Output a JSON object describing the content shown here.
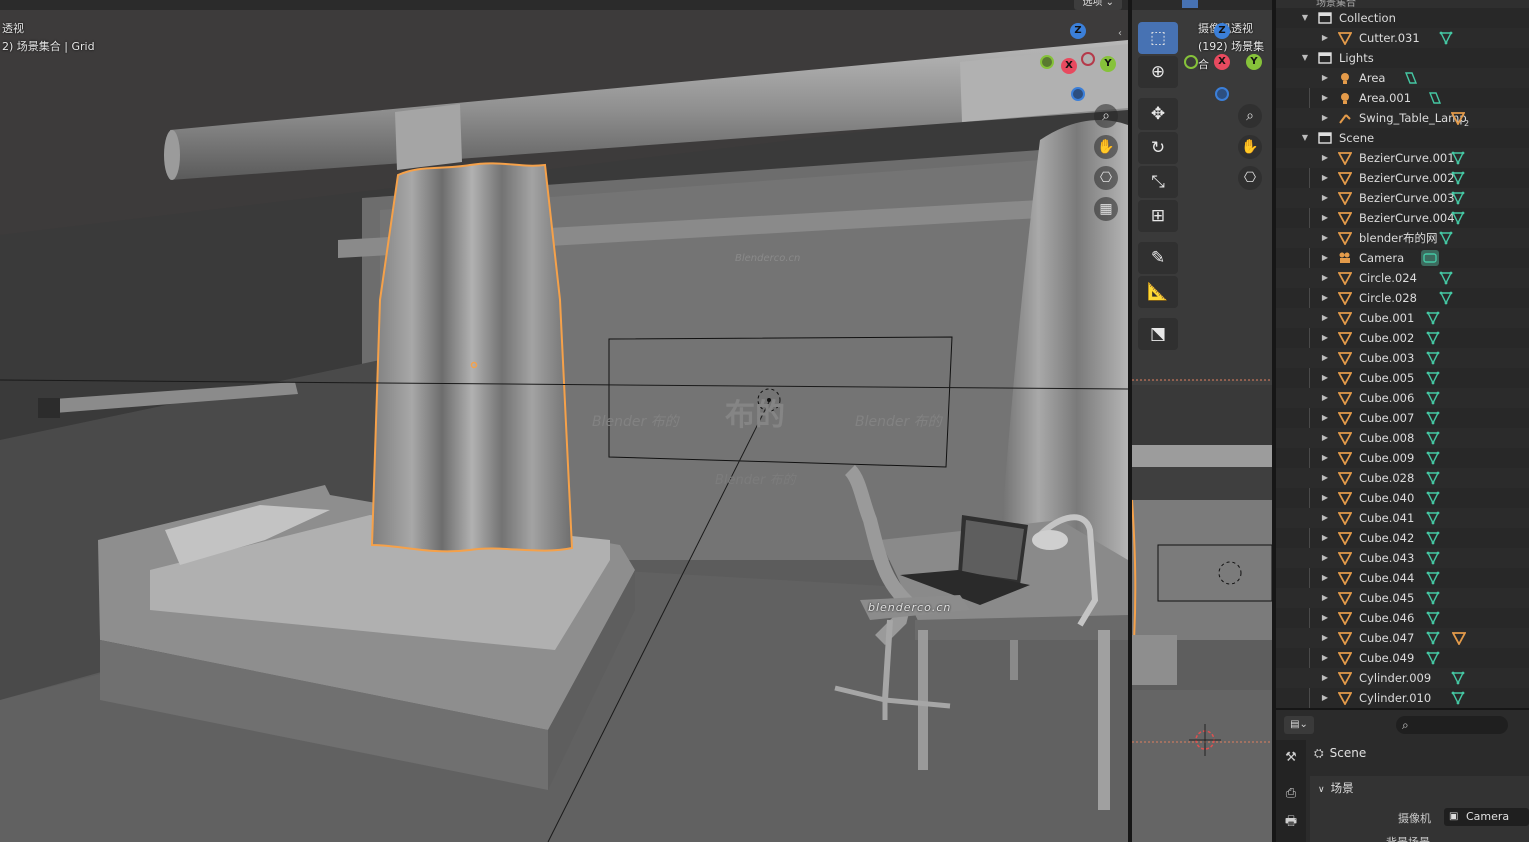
{
  "viewport_main": {
    "label_line1": "透视",
    "label_line2": "2) 场景集合 | Grid",
    "options_label": "选项 ⌄",
    "watermarks": [
      "Blenderco.cn",
      "布的",
      "Blender 布的",
      "Blender 布的",
      "Blender 布的",
      "blenderco.cn"
    ],
    "axes": {
      "z": "Z",
      "x": "X",
      "y": "Y"
    },
    "nav_tools": [
      "zoom-icon",
      "hand-icon",
      "camera-icon",
      "grid-icon"
    ]
  },
  "viewport_side": {
    "label_line1": "摄像机透视",
    "label_line2": "(192) 场景集合",
    "axes": {
      "z": "Z",
      "x": "X",
      "y": "Y"
    },
    "tools": [
      "select-box-icon",
      "cursor-icon",
      "move-icon",
      "rotate-icon",
      "scale-icon",
      "transform-icon",
      "annotate-icon",
      "measure-icon",
      "add-cube-icon"
    ]
  },
  "outliner": {
    "header": "场景集合",
    "rows": [
      {
        "name": "Collection",
        "type": "collection",
        "depth": 0,
        "expanded": true
      },
      {
        "name": "Cutter.031",
        "type": "mesh",
        "depth": 1,
        "extra": "mesh-data"
      },
      {
        "name": "Lights",
        "type": "collection",
        "depth": 0,
        "expanded": true
      },
      {
        "name": "Area",
        "type": "light",
        "depth": 1,
        "extra": "light-data"
      },
      {
        "name": "Area.001",
        "type": "light",
        "depth": 1,
        "extra": "light-data"
      },
      {
        "name": "Swing_Table_Lamp",
        "type": "armature",
        "depth": 1,
        "extra": "mesh-multi",
        "extra_count": "2"
      },
      {
        "name": "Scene",
        "type": "collection",
        "depth": 0,
        "expanded": true
      },
      {
        "name": "BezierCurve.001",
        "type": "mesh",
        "depth": 1,
        "extra": "mesh-data"
      },
      {
        "name": "BezierCurve.002",
        "type": "mesh",
        "depth": 1,
        "extra": "mesh-data"
      },
      {
        "name": "BezierCurve.003",
        "type": "mesh",
        "depth": 1,
        "extra": "mesh-data"
      },
      {
        "name": "BezierCurve.004",
        "type": "mesh",
        "depth": 1,
        "extra": "mesh-data"
      },
      {
        "name": "blender布的网",
        "type": "mesh",
        "depth": 1,
        "extra": "mesh-data"
      },
      {
        "name": "Camera",
        "type": "camera",
        "depth": 1,
        "extra": "camera-data"
      },
      {
        "name": "Circle.024",
        "type": "mesh",
        "depth": 1,
        "extra": "mesh-data"
      },
      {
        "name": "Circle.028",
        "type": "mesh",
        "depth": 1,
        "extra": "mesh-data"
      },
      {
        "name": "Cube.001",
        "type": "mesh",
        "depth": 1,
        "extra": "mesh-data"
      },
      {
        "name": "Cube.002",
        "type": "mesh",
        "depth": 1,
        "extra": "mesh-data"
      },
      {
        "name": "Cube.003",
        "type": "mesh",
        "depth": 1,
        "extra": "mesh-data"
      },
      {
        "name": "Cube.005",
        "type": "mesh",
        "depth": 1,
        "extra": "mesh-data"
      },
      {
        "name": "Cube.006",
        "type": "mesh",
        "depth": 1,
        "extra": "mesh-data"
      },
      {
        "name": "Cube.007",
        "type": "mesh",
        "depth": 1,
        "extra": "mesh-data"
      },
      {
        "name": "Cube.008",
        "type": "mesh",
        "depth": 1,
        "extra": "mesh-data"
      },
      {
        "name": "Cube.009",
        "type": "mesh",
        "depth": 1,
        "extra": "mesh-data"
      },
      {
        "name": "Cube.028",
        "type": "mesh",
        "depth": 1,
        "extra": "mesh-data"
      },
      {
        "name": "Cube.040",
        "type": "mesh",
        "depth": 1,
        "extra": "mesh-data"
      },
      {
        "name": "Cube.041",
        "type": "mesh",
        "depth": 1,
        "extra": "mesh-data"
      },
      {
        "name": "Cube.042",
        "type": "mesh",
        "depth": 1,
        "extra": "mesh-data"
      },
      {
        "name": "Cube.043",
        "type": "mesh",
        "depth": 1,
        "extra": "mesh-data"
      },
      {
        "name": "Cube.044",
        "type": "mesh",
        "depth": 1,
        "extra": "mesh-data"
      },
      {
        "name": "Cube.045",
        "type": "mesh",
        "depth": 1,
        "extra": "mesh-data"
      },
      {
        "name": "Cube.046",
        "type": "mesh",
        "depth": 1,
        "extra": "mesh-data"
      },
      {
        "name": "Cube.047",
        "type": "mesh",
        "depth": 1,
        "extra": "mesh-data",
        "extra2": "modifier-orange"
      },
      {
        "name": "Cube.049",
        "type": "mesh",
        "depth": 1,
        "extra": "mesh-data"
      },
      {
        "name": "Cylinder.009",
        "type": "mesh",
        "depth": 1,
        "extra": "mesh-data"
      },
      {
        "name": "Cylinder.010",
        "type": "mesh",
        "depth": 1,
        "extra": "mesh-data"
      }
    ]
  },
  "properties": {
    "mode_label": "⌄",
    "scene_name": "Scene",
    "panel_title": "场景",
    "camera_label": "摄像机",
    "camera_value": "Camera",
    "bg_label": "背景场景",
    "tabs": [
      "tool-icon",
      "render-icon",
      "output-icon"
    ]
  },
  "colors": {
    "selection_orange": "#f5a14a",
    "mesh_orange": "#e49b4a",
    "data_green": "#45c7a3",
    "active_tool": "#4772b3",
    "axis_x": "#e84a5f",
    "axis_y": "#86c23a",
    "axis_z": "#3b7fd9"
  }
}
